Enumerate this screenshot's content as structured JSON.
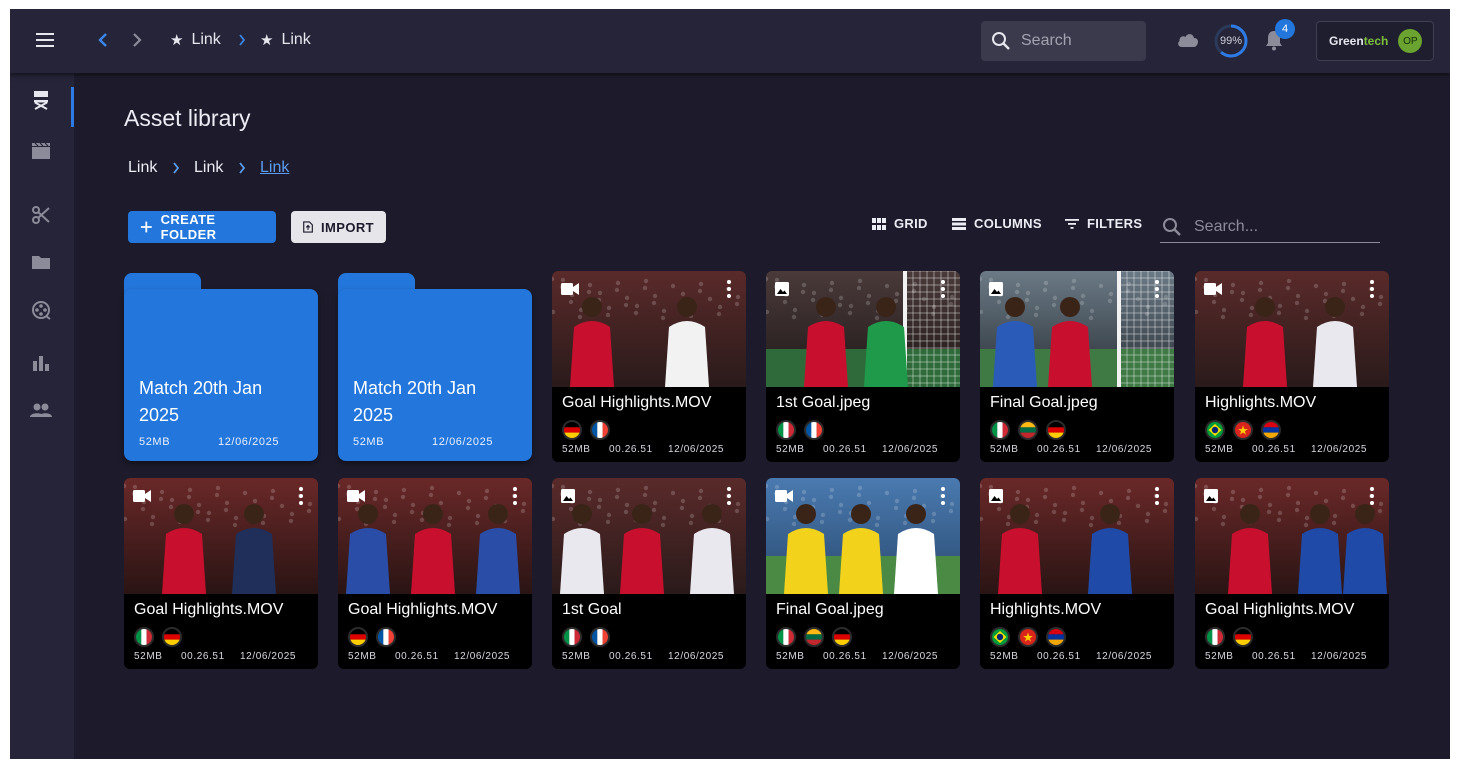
{
  "topbar": {
    "menu_icon": "hamburger-menu-icon",
    "breadcrumb": [
      "Link",
      "Link"
    ],
    "search_placeholder": "Search",
    "upload_progress": "99%",
    "upload_progress_value": 0.99,
    "notification_count": "4",
    "brand_prefix": "Green",
    "brand_suffix": "tech",
    "user_initials": "OP"
  },
  "sidebar": {
    "items": [
      "director-chair-icon",
      "clapperboard-icon",
      "scissors-icon",
      "folder-icon",
      "film-reel-icon",
      "bar-chart-icon",
      "people-icon"
    ],
    "active_index": 0
  },
  "page": {
    "title": "Asset library",
    "breadcrumb": [
      "Link",
      "Link",
      "Link"
    ],
    "create_folder_label": "CREATE FOLDER",
    "import_label": "IMPORT",
    "grid_label": "GRID",
    "columns_label": "COLUMNS",
    "filters_label": "FILTERS",
    "search_placeholder": "Search..."
  },
  "folders": [
    {
      "name": "Match 20th Jan 2025",
      "size": "52MB",
      "date": "12/06/2025"
    },
    {
      "name": "Match 20th Jan 2025",
      "size": "52MB",
      "date": "12/06/2025"
    }
  ],
  "assets": [
    {
      "name": "Goal Highlights.MOV",
      "type": "video",
      "flags": [
        "germany",
        "france"
      ],
      "size": "52MB",
      "duration": "00.26.51",
      "date": "12/06/2025"
    },
    {
      "name": "1st Goal.jpeg",
      "type": "image",
      "flags": [
        "italy",
        "france"
      ],
      "size": "52MB",
      "duration": "00.26.51",
      "date": "12/06/2025"
    },
    {
      "name": "Final Goal.jpeg",
      "type": "image",
      "flags": [
        "italy",
        "lithuania",
        "germany"
      ],
      "size": "52MB",
      "duration": "00.26.51",
      "date": "12/06/2025"
    },
    {
      "name": "Highlights.MOV",
      "type": "video",
      "flags": [
        "brazil",
        "vietnam",
        "armenia"
      ],
      "size": "52MB",
      "duration": "00.26.51",
      "date": "12/06/2025"
    },
    {
      "name": "Goal Highlights.MOV",
      "type": "video",
      "flags": [
        "italy",
        "germany"
      ],
      "size": "52MB",
      "duration": "00.26.51",
      "date": "12/06/2025"
    },
    {
      "name": "Goal Highlights.MOV",
      "type": "video",
      "flags": [
        "germany",
        "france"
      ],
      "size": "52MB",
      "duration": "00.26.51",
      "date": "12/06/2025"
    },
    {
      "name": "1st Goal",
      "type": "image",
      "flags": [
        "italy",
        "france"
      ],
      "size": "52MB",
      "duration": "00.26.51",
      "date": "12/06/2025"
    },
    {
      "name": "Final Goal.jpeg",
      "type": "video",
      "flags": [
        "italy",
        "lithuania",
        "germany"
      ],
      "size": "52MB",
      "duration": "00.26.51",
      "date": "12/06/2025"
    },
    {
      "name": "Highlights.MOV",
      "type": "image",
      "flags": [
        "brazil",
        "vietnam",
        "armenia"
      ],
      "size": "52MB",
      "duration": "00.26.51",
      "date": "12/06/2025"
    },
    {
      "name": "Goal Highlights.MOV",
      "type": "image",
      "flags": [
        "italy",
        "germany"
      ],
      "size": "52MB",
      "duration": "00.26.51",
      "date": "12/06/2025"
    }
  ],
  "colors": {
    "background": "#1d1b2b",
    "bar": "#252438",
    "accent": "#2376db",
    "brand_green": "#7cbf3a"
  }
}
